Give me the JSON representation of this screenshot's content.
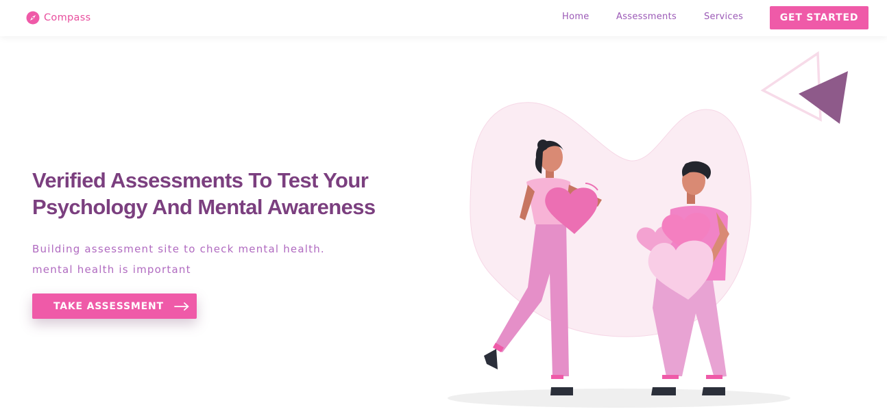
{
  "colors": {
    "brand": "#ef5aa8",
    "nav_text": "#9b59b6",
    "heading": "#7b3f7f",
    "subtext": "#b06ac0",
    "blob": "#fbecf3",
    "triangle_solid": "#8e5a8a"
  },
  "nav": {
    "logo_text": "Compass",
    "logo_icon": "compass-icon",
    "links": [
      "Home",
      "Assessments",
      "Services"
    ],
    "cta_label": "GET STARTED"
  },
  "hero": {
    "title_lines": [
      "Verified Assessments To Test Your",
      "Psychology And Mental Awareness"
    ],
    "subtitle_lines": [
      "Building assessment site to check mental health.",
      "mental health is important"
    ],
    "cta_label": "TAKE ASSESSMENT",
    "cta_icon": "arrow-right-icon"
  },
  "illustration": {
    "icons": [
      "woman-holding-heart-icon",
      "man-holding-hearts-icon",
      "triangle-outline-icon",
      "triangle-solid-icon"
    ]
  }
}
